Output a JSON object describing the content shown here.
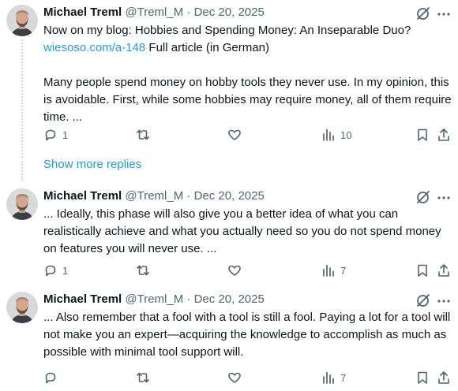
{
  "show_more_replies": "Show more replies",
  "tweets": [
    {
      "name": "Michael Treml",
      "handle": "@Treml_M",
      "separator": "·",
      "date": "Dec 20, 2025",
      "text_line1": "Now on my blog: Hobbies and Spending Money: An Inseparable Duo?",
      "link": "wiesoso.com/a-148",
      "after_link": " Full article (in German)",
      "text_para2": "Many people spend money on hobby tools they never use. In my opinion, this is avoidable. First, while some hobbies may require money, all of them require time. ...",
      "reply_count": "1",
      "view_count": "10"
    },
    {
      "name": "Michael Treml",
      "handle": "@Treml_M",
      "separator": "·",
      "date": "Dec 20, 2025",
      "text": "... Ideally, this phase will also give you a better idea of what you can realistically achieve and what you actually need so you do not spend money on features you will never use. ...",
      "reply_count": "1",
      "view_count": "7"
    },
    {
      "name": "Michael Treml",
      "handle": "@Treml_M",
      "separator": "·",
      "date": "Dec 20, 2025",
      "text": "... Also remember that a fool with a tool is still a fool. Paying a lot for a tool will not make you an expert—acquiring the knowledge to accomplish as much as possible with minimal tool support will.",
      "view_count": "7"
    }
  ],
  "icons": {
    "reply": "reply-icon",
    "retweet": "retweet-icon",
    "like": "heart-icon",
    "views": "views-icon",
    "bookmark": "bookmark-icon",
    "share": "share-icon",
    "grok": "grok-icon",
    "more": "more-icon"
  },
  "colors": {
    "text": "#0f1419",
    "secondary": "#536471",
    "link": "#1d9bf0",
    "thread_line": "#cfd9de"
  }
}
